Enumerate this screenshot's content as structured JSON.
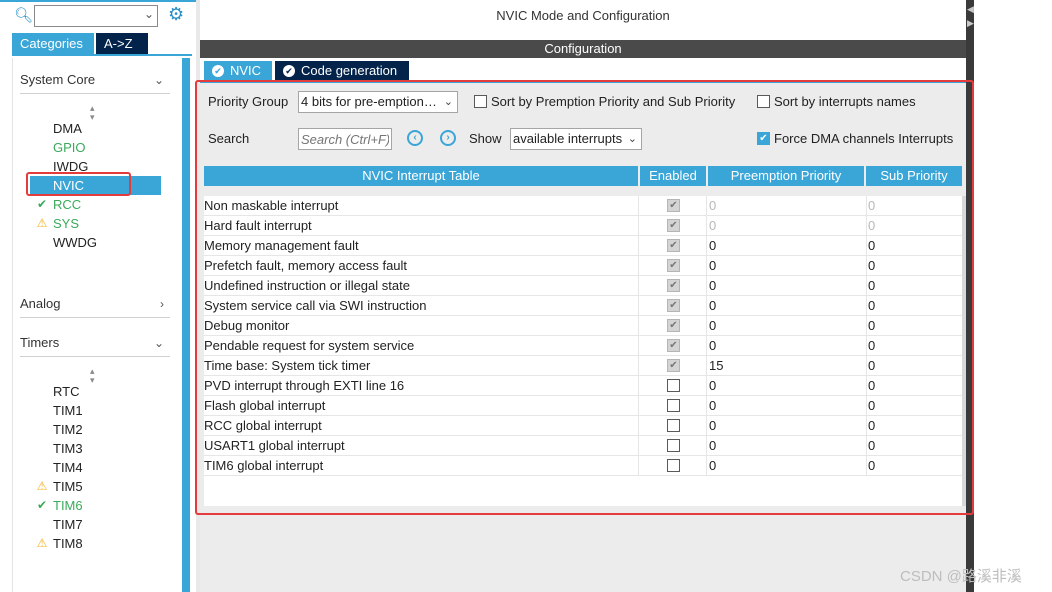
{
  "left": {
    "search_value": "",
    "tabs": [
      {
        "label": "Categories",
        "active": true
      },
      {
        "label": "A->Z",
        "active": false
      }
    ],
    "sections": [
      {
        "label": "System Core",
        "expanded": true
      },
      {
        "label": "Analog",
        "expanded": false
      },
      {
        "label": "Timers",
        "expanded": true
      }
    ],
    "system_core_items": [
      {
        "label": "DMA",
        "status": "none"
      },
      {
        "label": "GPIO",
        "status": "configured"
      },
      {
        "label": "IWDG",
        "status": "none"
      },
      {
        "label": "NVIC",
        "status": "selected"
      },
      {
        "label": "RCC",
        "status": "ok"
      },
      {
        "label": "SYS",
        "status": "warning"
      },
      {
        "label": "WWDG",
        "status": "none"
      }
    ],
    "timer_items": [
      {
        "label": "RTC",
        "status": "none"
      },
      {
        "label": "TIM1",
        "status": "none"
      },
      {
        "label": "TIM2",
        "status": "none"
      },
      {
        "label": "TIM3",
        "status": "none"
      },
      {
        "label": "TIM4",
        "status": "none"
      },
      {
        "label": "TIM5",
        "status": "warning"
      },
      {
        "label": "TIM6",
        "status": "ok"
      },
      {
        "label": "TIM7",
        "status": "none"
      },
      {
        "label": "TIM8",
        "status": "warning"
      }
    ]
  },
  "main": {
    "title": "NVIC Mode and Configuration",
    "config_bar": "Configuration",
    "tabs": [
      {
        "label": "NVIC"
      },
      {
        "label": "Code generation"
      }
    ],
    "priority_group_label": "Priority Group",
    "priority_group_value": "4 bits for pre-emption…",
    "sort_premption_label": "Sort by Premption Priority and Sub Priority",
    "sort_names_label": "Sort by interrupts names",
    "search_label": "Search",
    "search_placeholder": "Search (Ctrl+F)",
    "show_label": "Show",
    "show_value": "available interrupts",
    "force_dma_label": "Force DMA channels Interrupts",
    "table": {
      "headers": [
        "NVIC Interrupt Table",
        "Enabled",
        "Preemption Priority",
        "Sub Priority"
      ],
      "rows": [
        {
          "name": "Non maskable interrupt",
          "enabled": true,
          "locked": true,
          "pre": "0",
          "sub": "0"
        },
        {
          "name": "Hard fault interrupt",
          "enabled": true,
          "locked": true,
          "pre": "0",
          "sub": "0"
        },
        {
          "name": "Memory management fault",
          "enabled": true,
          "locked": false,
          "pre": "0",
          "sub": "0"
        },
        {
          "name": "Prefetch fault, memory access fault",
          "enabled": true,
          "locked": false,
          "pre": "0",
          "sub": "0"
        },
        {
          "name": "Undefined instruction or illegal state",
          "enabled": true,
          "locked": false,
          "pre": "0",
          "sub": "0"
        },
        {
          "name": "System service call via SWI instruction",
          "enabled": true,
          "locked": false,
          "pre": "0",
          "sub": "0"
        },
        {
          "name": "Debug monitor",
          "enabled": true,
          "locked": false,
          "pre": "0",
          "sub": "0"
        },
        {
          "name": "Pendable request for system service",
          "enabled": true,
          "locked": false,
          "pre": "0",
          "sub": "0"
        },
        {
          "name": "Time base: System tick timer",
          "enabled": true,
          "locked": false,
          "pre": "15",
          "sub": "0"
        },
        {
          "name": "PVD interrupt through EXTI line 16",
          "enabled": false,
          "locked": false,
          "pre": "0",
          "sub": "0"
        },
        {
          "name": "Flash global interrupt",
          "enabled": false,
          "locked": false,
          "pre": "0",
          "sub": "0"
        },
        {
          "name": "RCC global interrupt",
          "enabled": false,
          "locked": false,
          "pre": "0",
          "sub": "0"
        },
        {
          "name": "USART1 global interrupt",
          "enabled": false,
          "locked": false,
          "pre": "0",
          "sub": "0"
        },
        {
          "name": "TIM6 global interrupt",
          "enabled": false,
          "locked": false,
          "pre": "0",
          "sub": "0"
        }
      ]
    }
  },
  "watermark": "CSDN @路溪非溪",
  "colors": {
    "accent": "#3aa6d8",
    "dark_tab": "#03234b",
    "highlight_box": "#e43c3c",
    "ok": "#3aaa5a",
    "warning": "#f2b01e"
  }
}
